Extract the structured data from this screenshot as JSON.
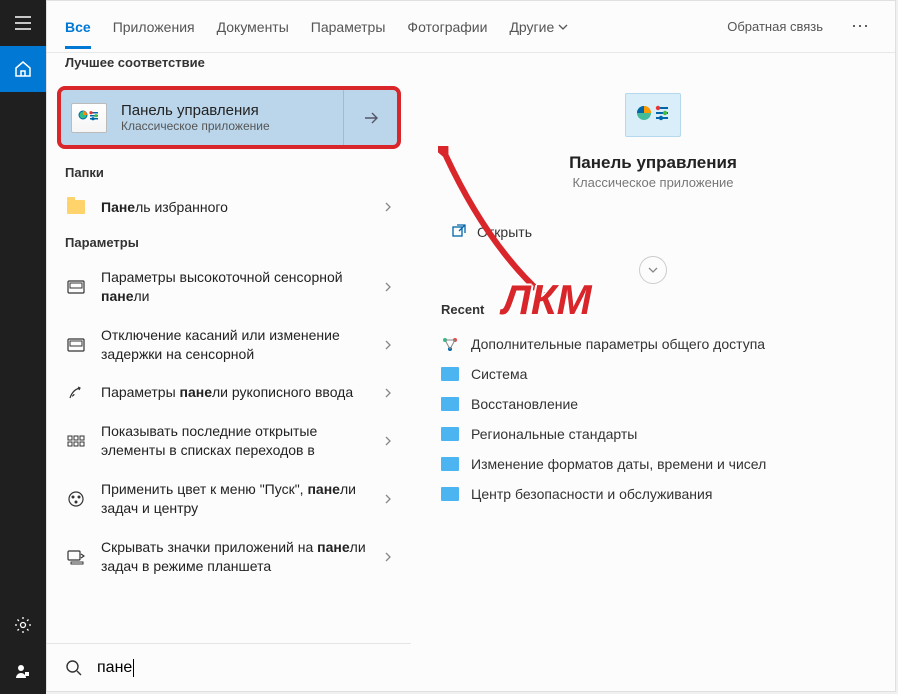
{
  "sidebar": {
    "menu": "menu",
    "home": "home",
    "settings": "settings",
    "account": "account"
  },
  "tabs": {
    "all": "Все",
    "apps": "Приложения",
    "docs": "Документы",
    "params": "Параметры",
    "photos": "Фотографии",
    "other": "Другие"
  },
  "header": {
    "feedback": "Обратная связь"
  },
  "sections": {
    "best_match": "Лучшее соответствие",
    "folders": "Папки",
    "settings": "Параметры"
  },
  "best": {
    "title": "Панель управления",
    "subtitle": "Классическое приложение"
  },
  "folders": [
    {
      "pre": "",
      "bold": "Пане",
      "post": "ль избранного"
    }
  ],
  "settings": [
    {
      "text": "Параметры высокоточной сенсорной <b>пане</b>ли"
    },
    {
      "text": "Отключение касаний или изменение задержки на сенсорной"
    },
    {
      "text": "Параметры <b>пане</b>ли рукописного ввода"
    },
    {
      "text": "Показывать последние открытые элементы в списках переходов в"
    },
    {
      "text": "Применить цвет к меню \"Пуск\", <b>пане</b>ли задач и центру"
    },
    {
      "text": "Скрывать значки приложений на <b>пане</b>ли задач в режиме планшета"
    }
  ],
  "preview": {
    "title": "Панель управления",
    "subtitle": "Классическое приложение",
    "open": "Открыть"
  },
  "recent": {
    "header": "Recent",
    "items": [
      "Дополнительные параметры общего доступа",
      "Система",
      "Восстановление",
      "Региональные стандарты",
      "Изменение форматов даты, времени и чисел",
      "Центр безопасности и обслуживания"
    ]
  },
  "search": {
    "value": "пане"
  },
  "annotation": {
    "text": "ЛКМ"
  }
}
